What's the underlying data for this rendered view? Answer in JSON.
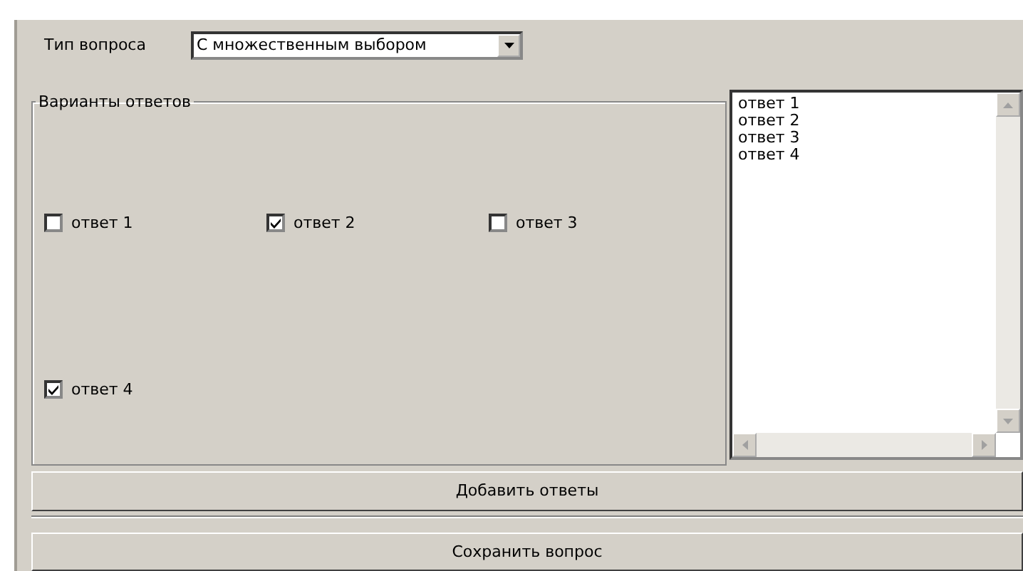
{
  "question_type": {
    "label": "Тип вопроса",
    "value": "С множественным выбором"
  },
  "answers_group": {
    "title": "Варианты ответов",
    "options": [
      {
        "label": "ответ 1",
        "checked": false
      },
      {
        "label": "ответ 2",
        "checked": true
      },
      {
        "label": "ответ 3",
        "checked": false
      },
      {
        "label": "ответ 4",
        "checked": true
      }
    ]
  },
  "answers_list": [
    "ответ 1",
    "ответ 2",
    "ответ 3",
    "ответ 4"
  ],
  "buttons": [
    "Добавить ответы",
    "Сохранить вопрос"
  ]
}
